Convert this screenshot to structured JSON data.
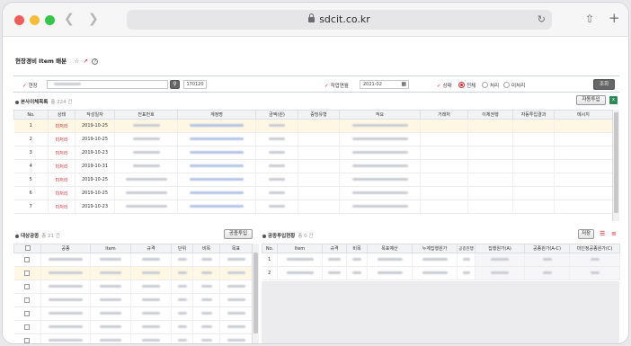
{
  "browser": {
    "url": "sdcit.co.kr"
  },
  "page": {
    "title": "현장경비 Item 배분"
  },
  "filters": {
    "site_label": "현장",
    "site_value": "",
    "site_code": "170120",
    "month_label": "작업연월",
    "month_value": "2021-02",
    "status_label": "상태",
    "status_options": [
      "전체",
      "처리",
      "미처리"
    ],
    "status_selected": "전체",
    "search_button": "조회"
  },
  "section1": {
    "title": "본사이체목록",
    "count": "총 224 건",
    "auto_input_button": "자동투입",
    "columns": [
      "No.",
      "상태",
      "작성일자",
      "전표번호",
      "계정명",
      "금액(원)",
      "증빙유형",
      "적요",
      "거래처",
      "이체권행",
      "자동투입결과",
      "메시지"
    ],
    "rows": [
      {
        "no": "1",
        "status": "미처리",
        "date": "2019-10-25"
      },
      {
        "no": "2",
        "status": "미처리",
        "date": "2019-10-25"
      },
      {
        "no": "3",
        "status": "미처리",
        "date": "2019-10-23"
      },
      {
        "no": "4",
        "status": "미처리",
        "date": "2019-10-31"
      },
      {
        "no": "5",
        "status": "미처리",
        "date": "2019-10-25"
      },
      {
        "no": "6",
        "status": "미처리",
        "date": "2019-10-25"
      },
      {
        "no": "7",
        "status": "미처리",
        "date": "2019-10-23"
      }
    ]
  },
  "section2": {
    "title": "대상공종",
    "count": "총 21 건",
    "button": "공종투입",
    "columns": [
      "",
      "공종",
      "Item",
      "규격",
      "단위",
      "비목",
      "목표"
    ],
    "row_count": 7
  },
  "section3": {
    "title": "공종투입현황",
    "count": "총 0 건",
    "save_button": "저장",
    "columns": [
      "No.",
      "Item",
      "규격",
      "비목",
      "목표예산",
      "누계집행원가",
      "공종진행",
      "집행원가(A)",
      "공종원가(A-C)",
      "미인정공종원가(C)"
    ],
    "rows": [
      {
        "no": "1"
      },
      {
        "no": "2"
      }
    ]
  },
  "colors": {
    "accent": "#d8262f",
    "selected_row": "#fdf7e4",
    "header_bg": "#f2f3f5"
  }
}
